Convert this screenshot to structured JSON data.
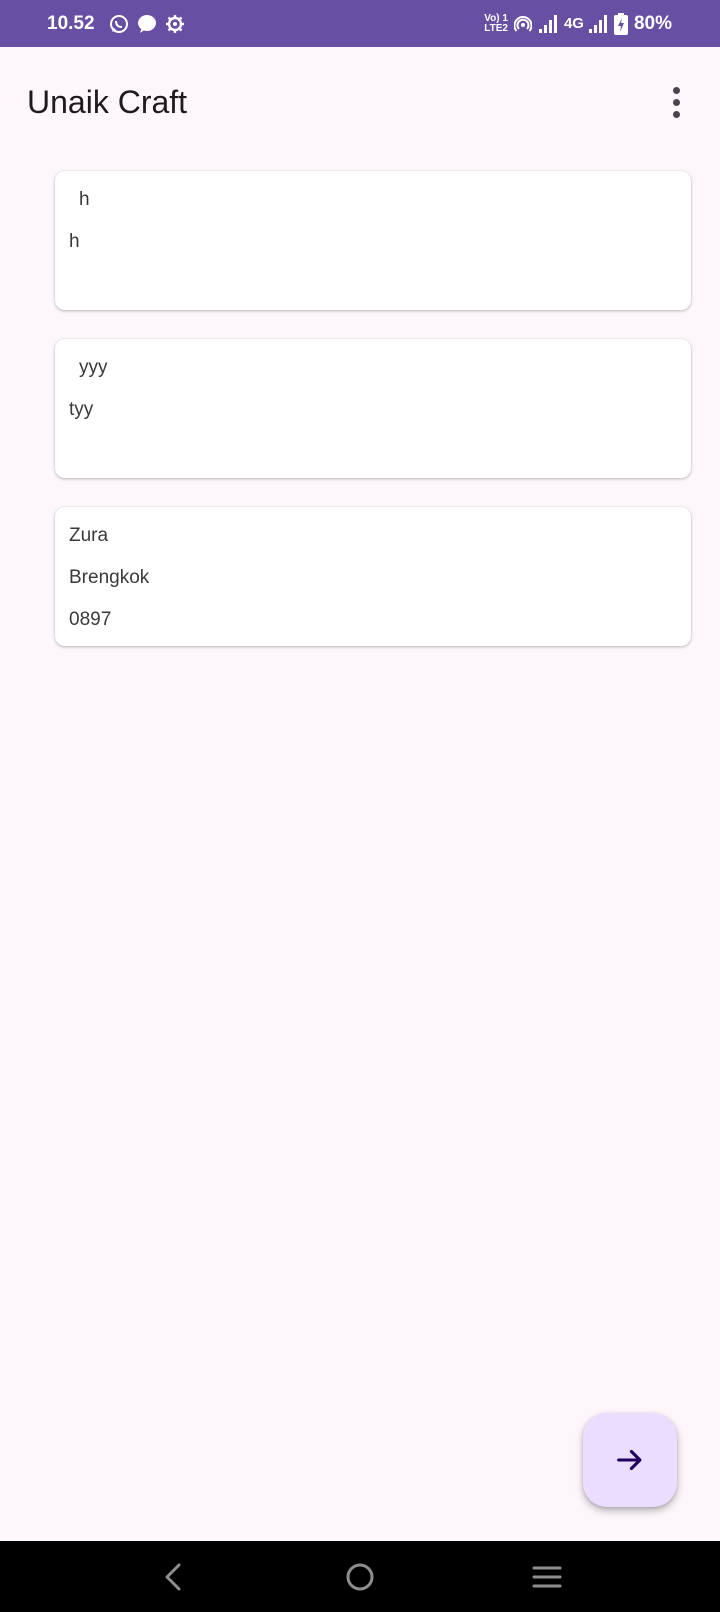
{
  "status_bar": {
    "time": "10.52",
    "left_icons": [
      "whatsapp-icon",
      "chat-bubble-icon",
      "settings-gear-icon"
    ],
    "volte_label_top": "Vo) 1",
    "volte_label_bottom": "LTE2",
    "network_type": "4G",
    "battery": "80%",
    "background": "#6750a4"
  },
  "app_bar": {
    "title": "Unaik Craft",
    "menu_icon": "more-vert-icon"
  },
  "cards": [
    {
      "line1": "h",
      "line2": "h",
      "line3": ""
    },
    {
      "line1": "yyy",
      "line2": "tyy",
      "line3": ""
    },
    {
      "line1": "Zura",
      "line2": "Brengkok",
      "line3": "0897"
    }
  ],
  "fab": {
    "icon": "arrow-right-icon",
    "background": "#eaddff",
    "icon_color": "#21005d"
  },
  "nav_bar": {
    "back_icon": "back-icon",
    "home_icon": "home-icon",
    "recents_icon": "recents-icon"
  }
}
